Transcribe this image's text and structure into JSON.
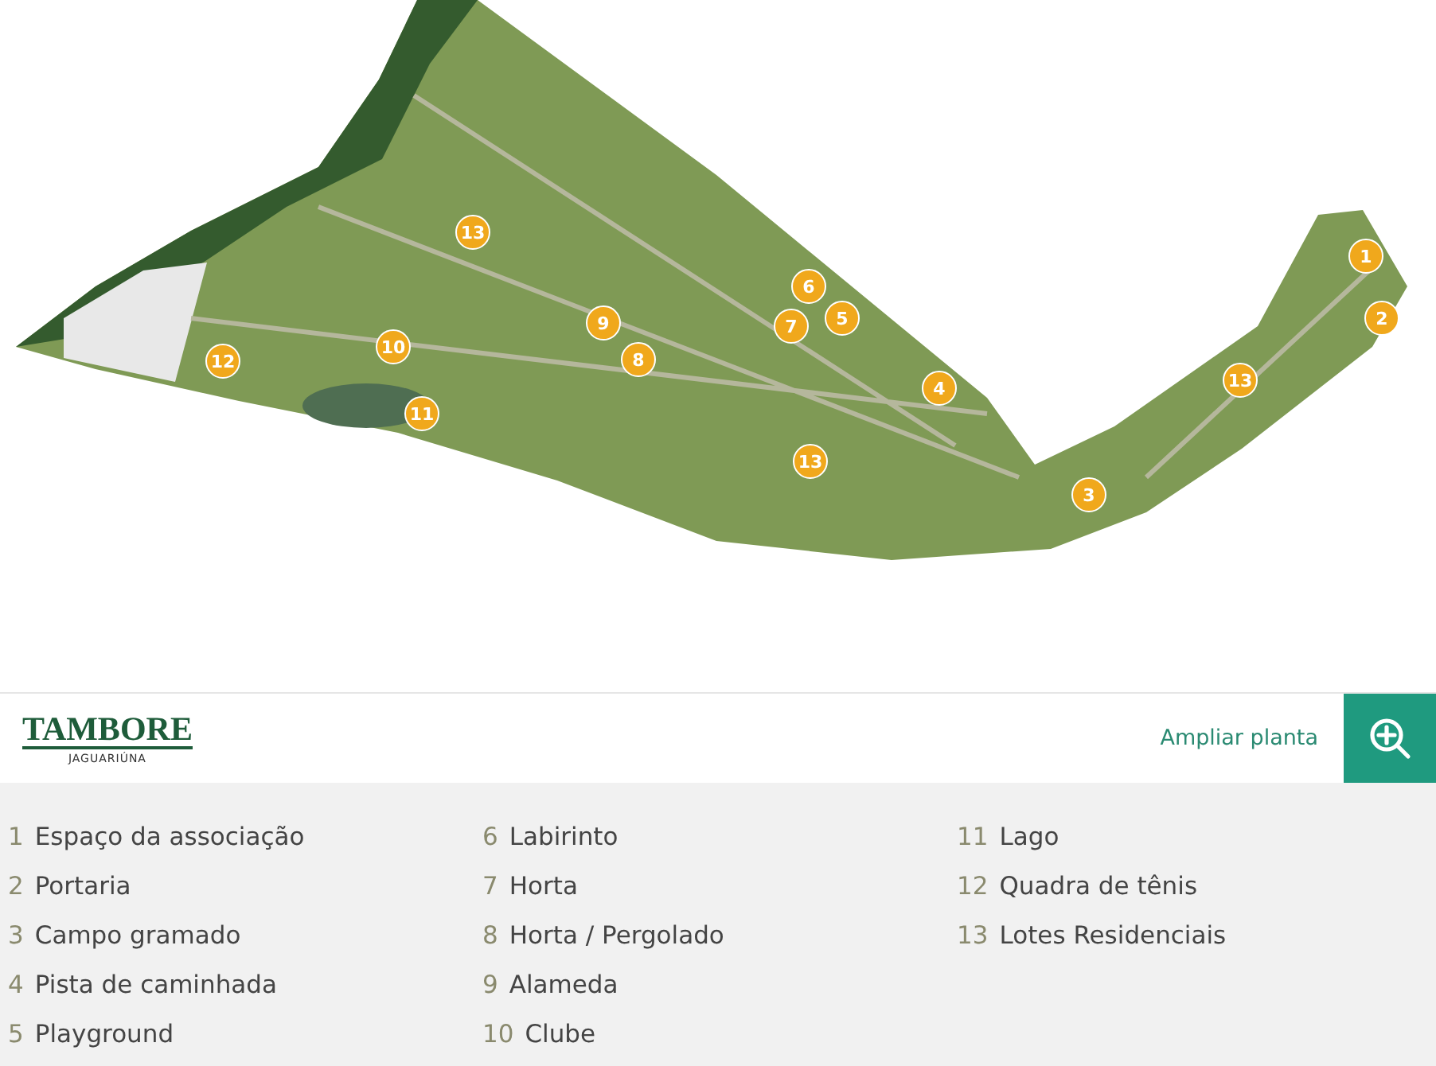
{
  "map": {
    "pins": [
      "13",
      "9",
      "8",
      "10",
      "12",
      "11",
      "6",
      "7",
      "5",
      "4",
      "13",
      "3",
      "1",
      "2",
      "13"
    ]
  },
  "brand": {
    "name": "TAMBORE",
    "place": "JAGUARIÚNA"
  },
  "zoom_link": {
    "label": "Ampliar planta"
  },
  "legend": [
    {
      "number": "1",
      "label": "Espaço da associação"
    },
    {
      "number": "2",
      "label": "Portaria"
    },
    {
      "number": "3",
      "label": "Campo gramado"
    },
    {
      "number": "4",
      "label": "Pista de caminhada"
    },
    {
      "number": "5",
      "label": "Playground"
    },
    {
      "number": "6",
      "label": "Labirinto"
    },
    {
      "number": "7",
      "label": "Horta"
    },
    {
      "number": "8",
      "label": "Horta / Pergolado"
    },
    {
      "number": "9",
      "label": "Alameda"
    },
    {
      "number": "10",
      "label": "Clube"
    },
    {
      "number": "11",
      "label": "Lago"
    },
    {
      "number": "12",
      "label": "Quadra de tênis"
    },
    {
      "number": "13",
      "label": "Lotes Residenciais"
    }
  ]
}
